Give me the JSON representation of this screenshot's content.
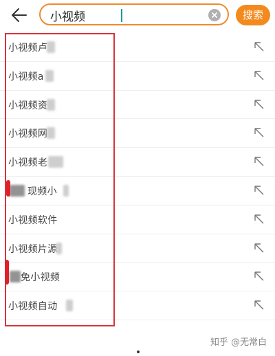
{
  "header": {
    "search_value": "小视频",
    "search_button_label": "搜索"
  },
  "suggestions": [
    {
      "text": "小视频卢"
    },
    {
      "text": "小视频a"
    },
    {
      "text": "小视频资"
    },
    {
      "text": "小视频网"
    },
    {
      "text": "小视频老"
    },
    {
      "text": "现频小"
    },
    {
      "text": "小视频软件"
    },
    {
      "text": "小视频片源"
    },
    {
      "text": "免小视频"
    },
    {
      "text": "小视频自动"
    }
  ],
  "watermark": "知乎 @无常白",
  "colors": {
    "accent": "#f28a1e",
    "highlight_border": "#d8333a"
  }
}
